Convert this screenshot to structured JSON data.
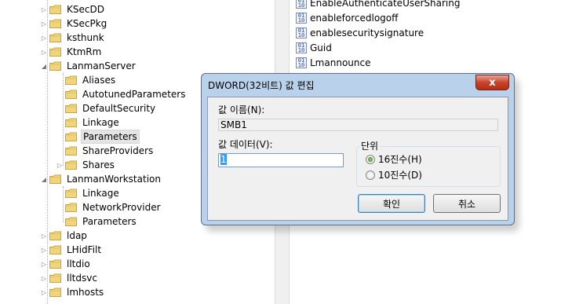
{
  "tree": {
    "items": [
      {
        "label": "KSecDD",
        "expander": "▷"
      },
      {
        "label": "KSecPkg",
        "expander": "▷"
      },
      {
        "label": "ksthunk",
        "expander": "▷"
      },
      {
        "label": "KtmRm",
        "expander": "▷"
      },
      {
        "label": "LanmanServer",
        "expander": "◢"
      },
      {
        "label": "Aliases",
        "expander": ""
      },
      {
        "label": "AutotunedParameters",
        "expander": ""
      },
      {
        "label": "DefaultSecurity",
        "expander": ""
      },
      {
        "label": "Linkage",
        "expander": ""
      },
      {
        "label": "Parameters",
        "expander": "",
        "selected": true
      },
      {
        "label": "ShareProviders",
        "expander": ""
      },
      {
        "label": "Shares",
        "expander": "▷"
      },
      {
        "label": "LanmanWorkstation",
        "expander": "◢"
      },
      {
        "label": "Linkage",
        "expander": ""
      },
      {
        "label": "NetworkProvider",
        "expander": ""
      },
      {
        "label": "Parameters",
        "expander": ""
      },
      {
        "label": "ldap",
        "expander": "▷"
      },
      {
        "label": "LHidFilt",
        "expander": "▷"
      },
      {
        "label": "lltdio",
        "expander": "▷"
      },
      {
        "label": "lltdsvc",
        "expander": "▷"
      },
      {
        "label": "lmhosts",
        "expander": "▷"
      }
    ]
  },
  "values": {
    "items": [
      {
        "label": "EnableAuthenticateUserSharing",
        "icon": "dword-value-icon"
      },
      {
        "label": "enableforcedlogoff",
        "icon": "dword-value-icon"
      },
      {
        "label": "enablesecuritysignature",
        "icon": "dword-value-icon"
      },
      {
        "label": "Guid",
        "icon": "binary-value-icon"
      },
      {
        "label": "Lmannounce",
        "icon": "dword-value-icon"
      }
    ]
  },
  "dialog": {
    "title": "DWORD(32비트) 값 편집",
    "close_glyph": "x",
    "value_name_label": "값 이름(N):",
    "value_name": "SMB1",
    "value_data_label": "값 데이터(V):",
    "value_data": "1",
    "base_label": "단위",
    "hex_label": "16진수(H)",
    "dec_label": "10진수(D)",
    "ok_label": "확인",
    "cancel_label": "취소"
  },
  "colors": {
    "dialog_frame": "#b9d1ea",
    "close_button": "#c9442c",
    "selection": "#3399ff"
  }
}
